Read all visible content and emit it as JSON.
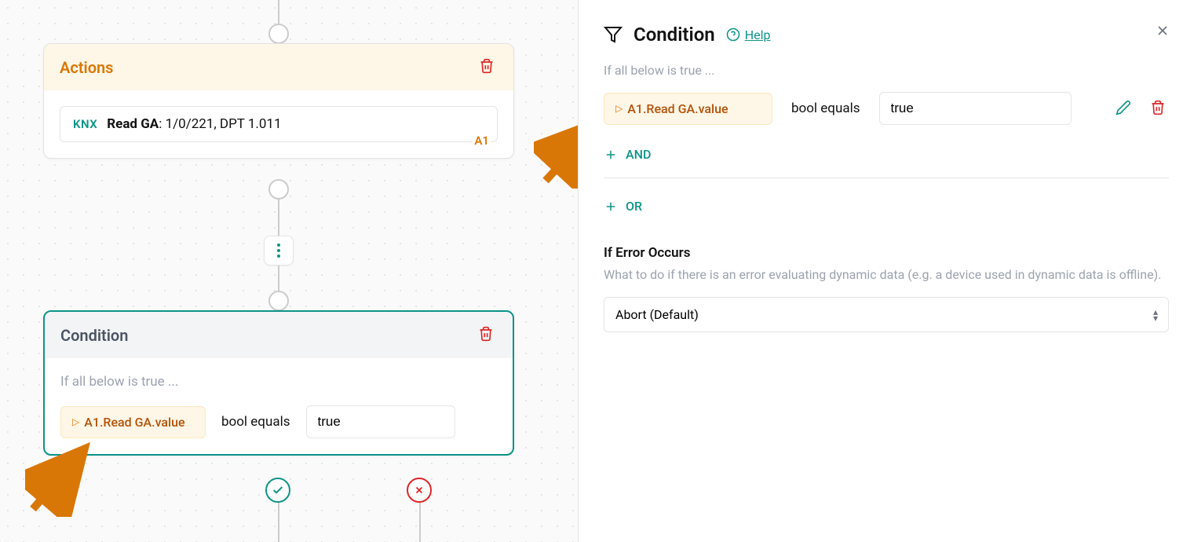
{
  "canvas": {
    "actions_card": {
      "title": "Actions",
      "knx_tag": "KNX",
      "action_label": "Read GA",
      "action_params": ": 1/0/221, DPT 1.011",
      "action_id": "A1"
    },
    "condition_card": {
      "title": "Condition",
      "subtitle": "If all below is true ...",
      "chip": "A1.Read GA.value",
      "operator": "bool equals",
      "value": "true"
    }
  },
  "panel": {
    "title": "Condition",
    "help": "Help",
    "subtitle": "If all below is true ...",
    "row": {
      "chip": "A1.Read GA.value",
      "operator": "bool equals",
      "value": "true"
    },
    "and_label": "AND",
    "or_label": "OR",
    "error_section": {
      "title": "If Error Occurs",
      "description": "What to do if there is an error evaluating dynamic data (e.g. a device used in dynamic data is offline).",
      "selected": "Abort (Default)"
    }
  }
}
